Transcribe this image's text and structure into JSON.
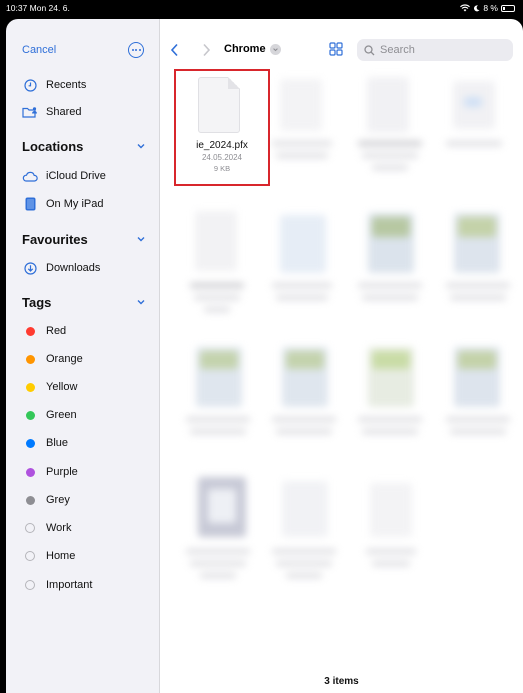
{
  "status": {
    "time": "10:37",
    "date": "Mon 24. 6.",
    "battery": "8 %"
  },
  "sidebar": {
    "cancel": "Cancel",
    "top_items": [
      {
        "label": "Recents",
        "icon": "clock-icon"
      },
      {
        "label": "Shared",
        "icon": "shared-folder-icon"
      }
    ],
    "locations_title": "Locations",
    "locations": [
      {
        "label": "iCloud Drive",
        "icon": "cloud-icon"
      },
      {
        "label": "On My iPad",
        "icon": "ipad-icon"
      }
    ],
    "favourites_title": "Favourites",
    "favourites": [
      {
        "label": "Downloads",
        "icon": "download-circle-icon"
      }
    ],
    "tags_title": "Tags",
    "tags": [
      {
        "label": "Red",
        "color": "#ff3b30"
      },
      {
        "label": "Orange",
        "color": "#ff9500"
      },
      {
        "label": "Yellow",
        "color": "#ffcc00"
      },
      {
        "label": "Green",
        "color": "#34c759"
      },
      {
        "label": "Blue",
        "color": "#007aff"
      },
      {
        "label": "Purple",
        "color": "#af52de"
      },
      {
        "label": "Grey",
        "color": "#8e8e93"
      },
      {
        "label": "Work",
        "color": "none"
      },
      {
        "label": "Home",
        "color": "none"
      },
      {
        "label": "Important",
        "color": "none"
      }
    ]
  },
  "main": {
    "folder": "Chrome",
    "search_placeholder": "Search",
    "selected_file": {
      "name": "ie_2024.pfx",
      "date": "24.05.2024",
      "size": "9 KB"
    },
    "items_count": "3 items"
  },
  "colors": {
    "accent": "#2f6fd8",
    "selection_border": "#d8262c"
  }
}
